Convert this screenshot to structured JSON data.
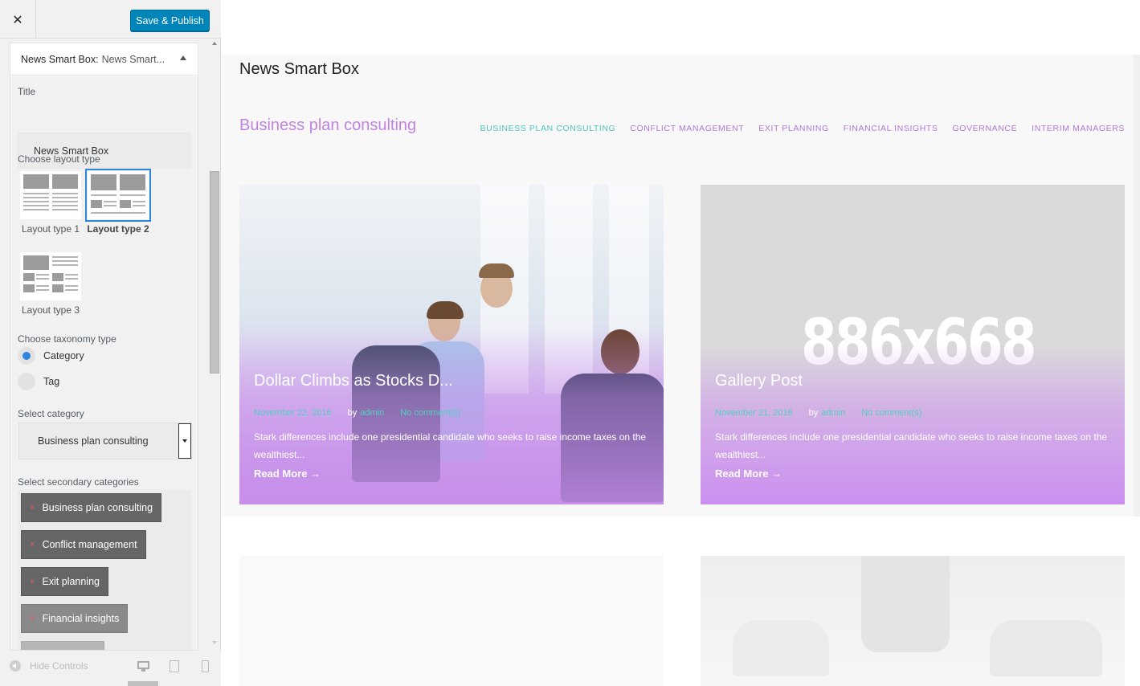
{
  "topbar": {
    "close_glyph": "✕",
    "publish_label": "Save & Publish"
  },
  "panel": {
    "header_prefix": "News Smart Box:",
    "header_suffix": "News Smart...",
    "title_label": "Title",
    "title_value": "News Smart Box",
    "layout_label": "Choose layout type",
    "layouts": [
      {
        "label": "Layout type 1",
        "selected": false
      },
      {
        "label": "Layout type 2",
        "selected": true
      },
      {
        "label": "Layout type 3",
        "selected": false
      }
    ],
    "taxonomy_label": "Choose taxonomy type",
    "taxonomy_options": [
      {
        "label": "Category",
        "checked": true
      },
      {
        "label": "Tag",
        "checked": false
      }
    ],
    "category_label": "Select category",
    "category_value": "Business plan consulting",
    "secondary_label": "Select secondary categories",
    "secondary_tags": [
      "Business plan consulting",
      "Conflict management",
      "Exit planning",
      "Financial insights"
    ],
    "tag_remove_glyph": "×"
  },
  "footer": {
    "hide_controls_label": "Hide Controls"
  },
  "preview": {
    "widget_title": "News Smart Box",
    "category_title": "Business plan consulting",
    "nav": [
      "BUSINESS PLAN CONSULTING",
      "CONFLICT MANAGEMENT",
      "EXIT PLANNING",
      "FINANCIAL INSIGHTS",
      "GOVERNANCE",
      "INTERIM MANAGERS"
    ],
    "cards": [
      {
        "title": "Dollar Climbs as Stocks D...",
        "date": "November 22, 2016",
        "by": "by",
        "author": "admin",
        "comments": "No comment(s)",
        "excerpt": "Stark differences include one presidential candidate who seeks to raise income taxes on the wealthiest...",
        "read_more": "Read More →"
      },
      {
        "title": "Gallery Post",
        "placeholder": "886x668",
        "date": "November 21, 2016",
        "by": "by",
        "author": "admin",
        "comments": "No comment(s)",
        "excerpt": "Stark differences include one presidential candidate who seeks to raise income taxes on the wealthiest...",
        "read_more": "Read More →"
      }
    ]
  },
  "colors": {
    "publish": "#0085ba",
    "accent_purple": "#c084e0",
    "accent_teal": "#4fc6b4",
    "selected_outline": "#2e85df"
  }
}
